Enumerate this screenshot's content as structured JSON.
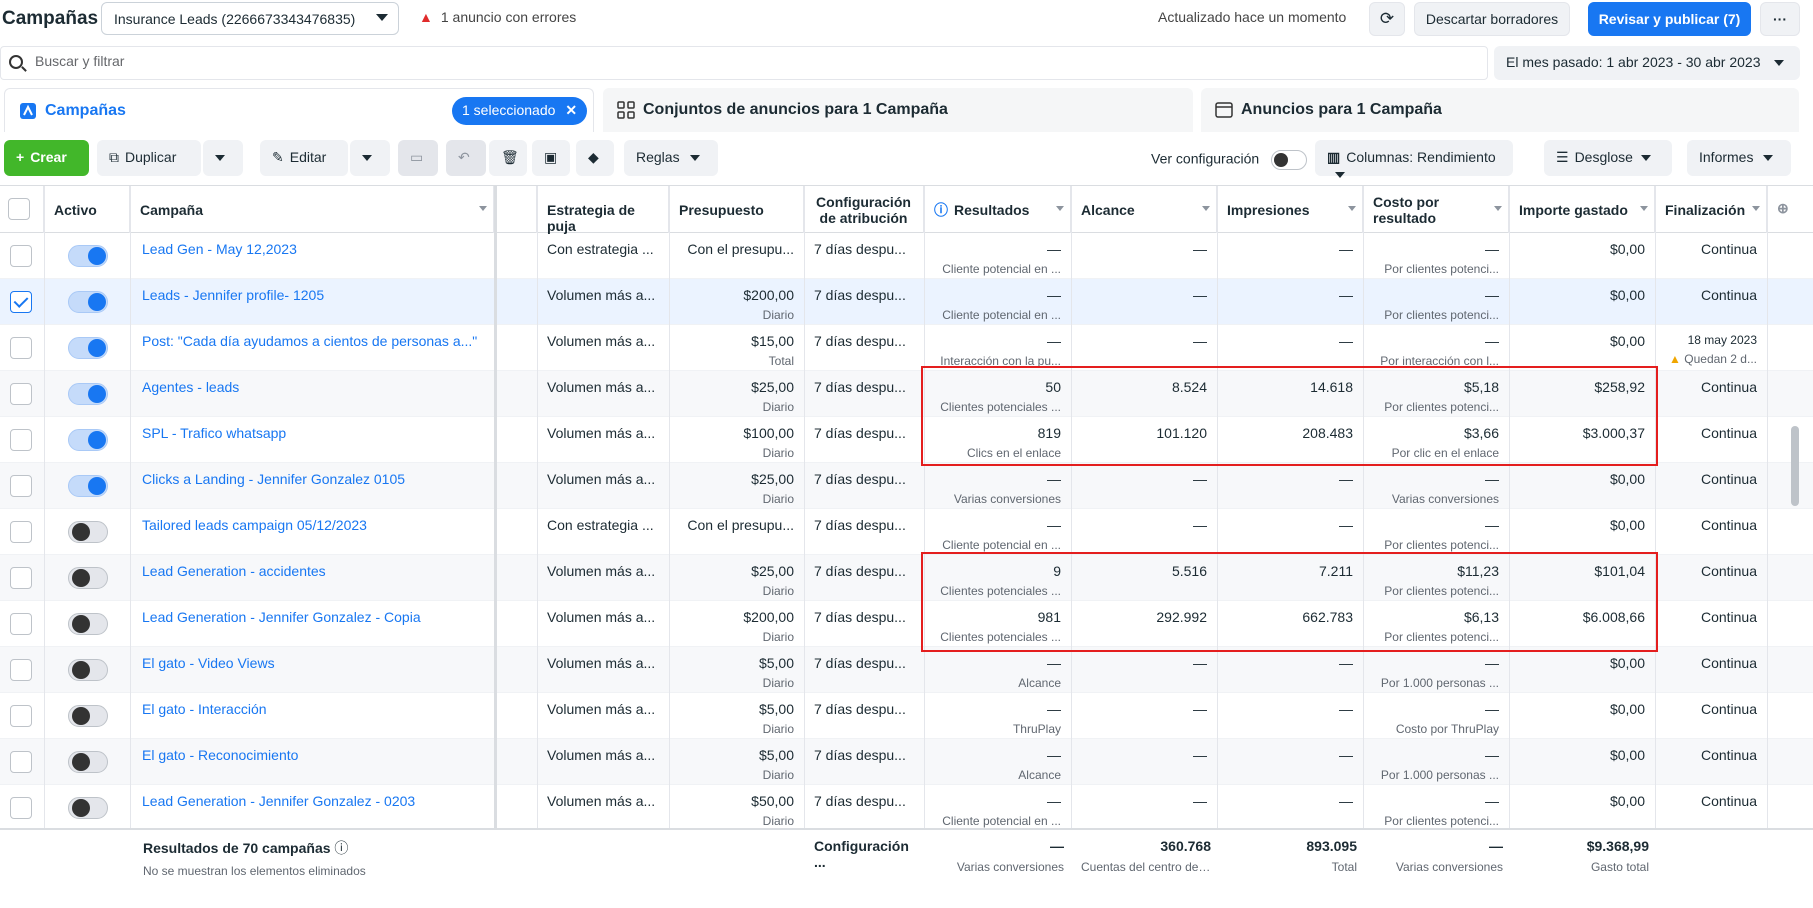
{
  "header": {
    "title": "Campañas",
    "account": "Insurance Leads (2266673343476835)",
    "error_text": "1 anuncio con errores",
    "updated": "Actualizado hace un momento",
    "discard": "Descartar borradores",
    "publish": "Revisar y publicar (7)",
    "more": "···"
  },
  "search": {
    "placeholder": "Buscar y filtrar",
    "date_range": "El mes pasado: 1 abr 2023 - 30 abr 2023"
  },
  "tabs": {
    "campaigns": "Campañas",
    "selected_pill": "1 seleccionado",
    "adsets": "Conjuntos de anuncios para 1 Campaña",
    "ads": "Anuncios para 1 Campaña"
  },
  "toolbar": {
    "create": "Crear",
    "duplicate": "Duplicar",
    "edit": "Editar",
    "rules": "Reglas",
    "view_config": "Ver configuración",
    "columns": "Columnas: Rendimiento",
    "breakdown": "Desglose",
    "reports": "Informes"
  },
  "columns": {
    "active": "Activo",
    "campaign": "Campaña",
    "bid": "Estrategia de puja",
    "budget": "Presupuesto",
    "attribution": "Configuración de atribución",
    "results": "Resultados",
    "reach": "Alcance",
    "impressions": "Impresiones",
    "cost": "Costo por resultado",
    "spent": "Importe gastado",
    "end": "Finalización"
  },
  "rows": [
    {
      "name": "Lead Gen - May 12,2023",
      "bid": "Con estrategia ...",
      "budget": "Con el presupu...",
      "budget_sub": "",
      "attr": "7 días despu...",
      "results": "—",
      "results_sub": "Cliente potencial en ...",
      "reach": "—",
      "impr": "—",
      "cost": "—",
      "cost_sub": "Por clientes potenci...",
      "spent": "$0,00",
      "end": "Continua",
      "end_sub": ""
    },
    {
      "name": "Leads - Jennifer profile- 1205",
      "bid": "Volumen más a...",
      "budget": "$200,00",
      "budget_sub": "Diario",
      "attr": "7 días despu...",
      "results": "—",
      "results_sub": "Cliente potencial en ...",
      "reach": "—",
      "impr": "—",
      "cost": "—",
      "cost_sub": "Por clientes potenci...",
      "spent": "$0,00",
      "end": "Continua",
      "end_sub": ""
    },
    {
      "name": "Post: \"Cada día ayudamos a cientos de personas a...\"",
      "bid": "Volumen más a...",
      "budget": "$15,00",
      "budget_sub": "Total",
      "attr": "7 días despu...",
      "results": "—",
      "results_sub": "Interacción con la pu...",
      "reach": "—",
      "impr": "—",
      "cost": "—",
      "cost_sub": "Por interacción con l...",
      "spent": "$0,00",
      "end": "18 may 2023",
      "end_sub": "Quedan 2 d..."
    },
    {
      "name": "Agentes - leads",
      "bid": "Volumen más a...",
      "budget": "$25,00",
      "budget_sub": "Diario",
      "attr": "7 días despu...",
      "results": "50",
      "results_sub": "Clientes potenciales ...",
      "reach": "8.524",
      "impr": "14.618",
      "cost": "$5,18",
      "cost_sub": "Por clientes potenci...",
      "spent": "$258,92",
      "end": "Continua",
      "end_sub": ""
    },
    {
      "name": "SPL - Trafico whatsapp",
      "bid": "Volumen más a...",
      "budget": "$100,00",
      "budget_sub": "Diario",
      "attr": "7 días despu...",
      "results": "819",
      "results_sub": "Clics en el enlace",
      "reach": "101.120",
      "impr": "208.483",
      "cost": "$3,66",
      "cost_sub": "Por clic en el enlace",
      "spent": "$3.000,37",
      "end": "Continua",
      "end_sub": ""
    },
    {
      "name": "Clicks a Landing - Jennifer Gonzalez 0105",
      "bid": "Volumen más a...",
      "budget": "$25,00",
      "budget_sub": "Diario",
      "attr": "7 días despu...",
      "results": "—",
      "results_sub": "Varias conversiones",
      "reach": "—",
      "impr": "—",
      "cost": "—",
      "cost_sub": "Varias conversiones",
      "spent": "$0,00",
      "end": "Continua",
      "end_sub": ""
    },
    {
      "name": "Tailored leads campaign 05/12/2023",
      "bid": "Con estrategia ...",
      "budget": "Con el presupu...",
      "budget_sub": "",
      "attr": "7 días despu...",
      "results": "—",
      "results_sub": "Cliente potencial en ...",
      "reach": "—",
      "impr": "—",
      "cost": "—",
      "cost_sub": "Por clientes potenci...",
      "spent": "$0,00",
      "end": "Continua",
      "end_sub": ""
    },
    {
      "name": "Lead Generation - accidentes",
      "bid": "Volumen más a...",
      "budget": "$25,00",
      "budget_sub": "Diario",
      "attr": "7 días despu...",
      "results": "9",
      "results_sub": "Clientes potenciales ...",
      "reach": "5.516",
      "impr": "7.211",
      "cost": "$11,23",
      "cost_sub": "Por clientes potenci...",
      "spent": "$101,04",
      "end": "Continua",
      "end_sub": ""
    },
    {
      "name": "Lead Generation - Jennifer Gonzalez - Copia",
      "bid": "Volumen más a...",
      "budget": "$200,00",
      "budget_sub": "Diario",
      "attr": "7 días despu...",
      "results": "981",
      "results_sub": "Clientes potenciales ...",
      "reach": "292.992",
      "impr": "662.783",
      "cost": "$6,13",
      "cost_sub": "Por clientes potenci...",
      "spent": "$6.008,66",
      "end": "Continua",
      "end_sub": ""
    },
    {
      "name": "El gato - Video Views",
      "bid": "Volumen más a...",
      "budget": "$5,00",
      "budget_sub": "Diario",
      "attr": "7 días despu...",
      "results": "—",
      "results_sub": "Alcance",
      "reach": "—",
      "impr": "—",
      "cost": "—",
      "cost_sub": "Por 1.000 personas ...",
      "spent": "$0,00",
      "end": "Continua",
      "end_sub": ""
    },
    {
      "name": "El gato - Interacción",
      "bid": "Volumen más a...",
      "budget": "$5,00",
      "budget_sub": "Diario",
      "attr": "7 días despu...",
      "results": "—",
      "results_sub": "ThruPlay",
      "reach": "—",
      "impr": "—",
      "cost": "—",
      "cost_sub": "Costo por ThruPlay",
      "spent": "$0,00",
      "end": "Continua",
      "end_sub": ""
    },
    {
      "name": "El gato - Reconocimiento",
      "bid": "Volumen más a...",
      "budget": "$5,00",
      "budget_sub": "Diario",
      "attr": "7 días despu...",
      "results": "—",
      "results_sub": "Alcance",
      "reach": "—",
      "impr": "—",
      "cost": "—",
      "cost_sub": "Por 1.000 personas ...",
      "spent": "$0,00",
      "end": "Continua",
      "end_sub": ""
    },
    {
      "name": "Lead Generation - Jennifer Gonzalez - 0203",
      "bid": "Volumen más a...",
      "budget": "$50,00",
      "budget_sub": "Diario",
      "attr": "7 días despu...",
      "results": "—",
      "results_sub": "Cliente potencial en ...",
      "reach": "—",
      "impr": "—",
      "cost": "—",
      "cost_sub": "Por clientes potenci...",
      "spent": "$0,00",
      "end": "Continua",
      "end_sub": ""
    }
  ],
  "footer": {
    "title": "Resultados de 70 campañas",
    "subtitle": "No se muestran los elementos eliminados",
    "attribution": "Configuración ...",
    "results": "—",
    "results_sub": "Varias conversiones",
    "reach": "360.768",
    "reach_sub": "Cuentas del centro de ...",
    "impressions": "893.095",
    "impressions_sub": "Total",
    "cost": "—",
    "cost_sub": "Varias conversiones",
    "spent": "$9.368,99",
    "spent_sub": "Gasto total"
  }
}
